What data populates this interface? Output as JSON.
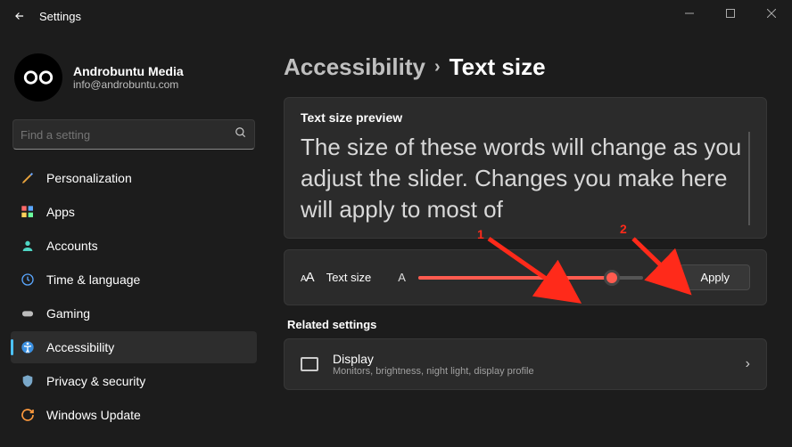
{
  "window": {
    "title": "Settings"
  },
  "profile": {
    "name": "Androbuntu Media",
    "email": "info@androbuntu.com"
  },
  "search": {
    "placeholder": "Find a setting"
  },
  "sidebar": {
    "items": [
      {
        "label": "Personalization"
      },
      {
        "label": "Apps"
      },
      {
        "label": "Accounts"
      },
      {
        "label": "Time & language"
      },
      {
        "label": "Gaming"
      },
      {
        "label": "Accessibility"
      },
      {
        "label": "Privacy & security"
      },
      {
        "label": "Windows Update"
      }
    ]
  },
  "breadcrumb": {
    "parent": "Accessibility",
    "current": "Text size"
  },
  "preview": {
    "title": "Text size preview",
    "body": "The size of these words will change as you adjust the slider. Changes you make here will apply to most of"
  },
  "textsize": {
    "label": "Text size",
    "apply": "Apply"
  },
  "related": {
    "heading": "Related settings",
    "display": {
      "title": "Display",
      "subtitle": "Monitors, brightness, night light, display profile"
    }
  },
  "annotations": {
    "one": "1",
    "two": "2"
  }
}
